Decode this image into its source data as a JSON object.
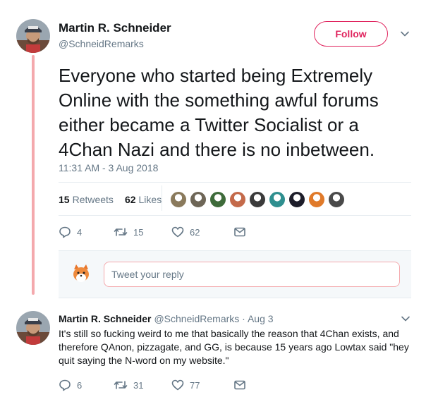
{
  "tweet": {
    "author_name": "Martin R. Schneider",
    "author_handle": "@SchneidRemarks",
    "follow_label": "Follow",
    "text": "Everyone who started being Extremely Online with the something awful forums either became a Twitter Socialist or a 4Chan Nazi and there is no inbetween.",
    "timestamp": "11:31 AM - 3 Aug 2018",
    "retweets_count": "15",
    "retweets_label": "Retweets",
    "likes_count": "62",
    "likes_label": "Likes",
    "actions": {
      "reply_count": "4",
      "retweet_count": "15",
      "like_count": "62"
    },
    "liker_avatar_colors": [
      "#8a7a5c",
      "#6e6657",
      "#3e6b3a",
      "#c46a4a",
      "#3b3b3b",
      "#2f8f8f",
      "#1d1d2a",
      "#e07a2a",
      "#4a4a4a"
    ]
  },
  "reply_box": {
    "placeholder": "Tweet your reply"
  },
  "reply": {
    "author_name": "Martin R. Schneider",
    "meta": "@SchneidRemarks · Aug 3",
    "text": "It's still so fucking weird to me that basically the reason that 4Chan exists, and therefore QAnon, pizzagate, and GG, is because 15 years ago Lowtax said \"hey quit saying the N-word on my website.\"",
    "actions": {
      "reply_count": "6",
      "retweet_count": "31",
      "like_count": "77"
    }
  },
  "colors": {
    "accent": "#e0245e",
    "thread_line": "#f4a9ad",
    "secondary_text": "#657786"
  }
}
